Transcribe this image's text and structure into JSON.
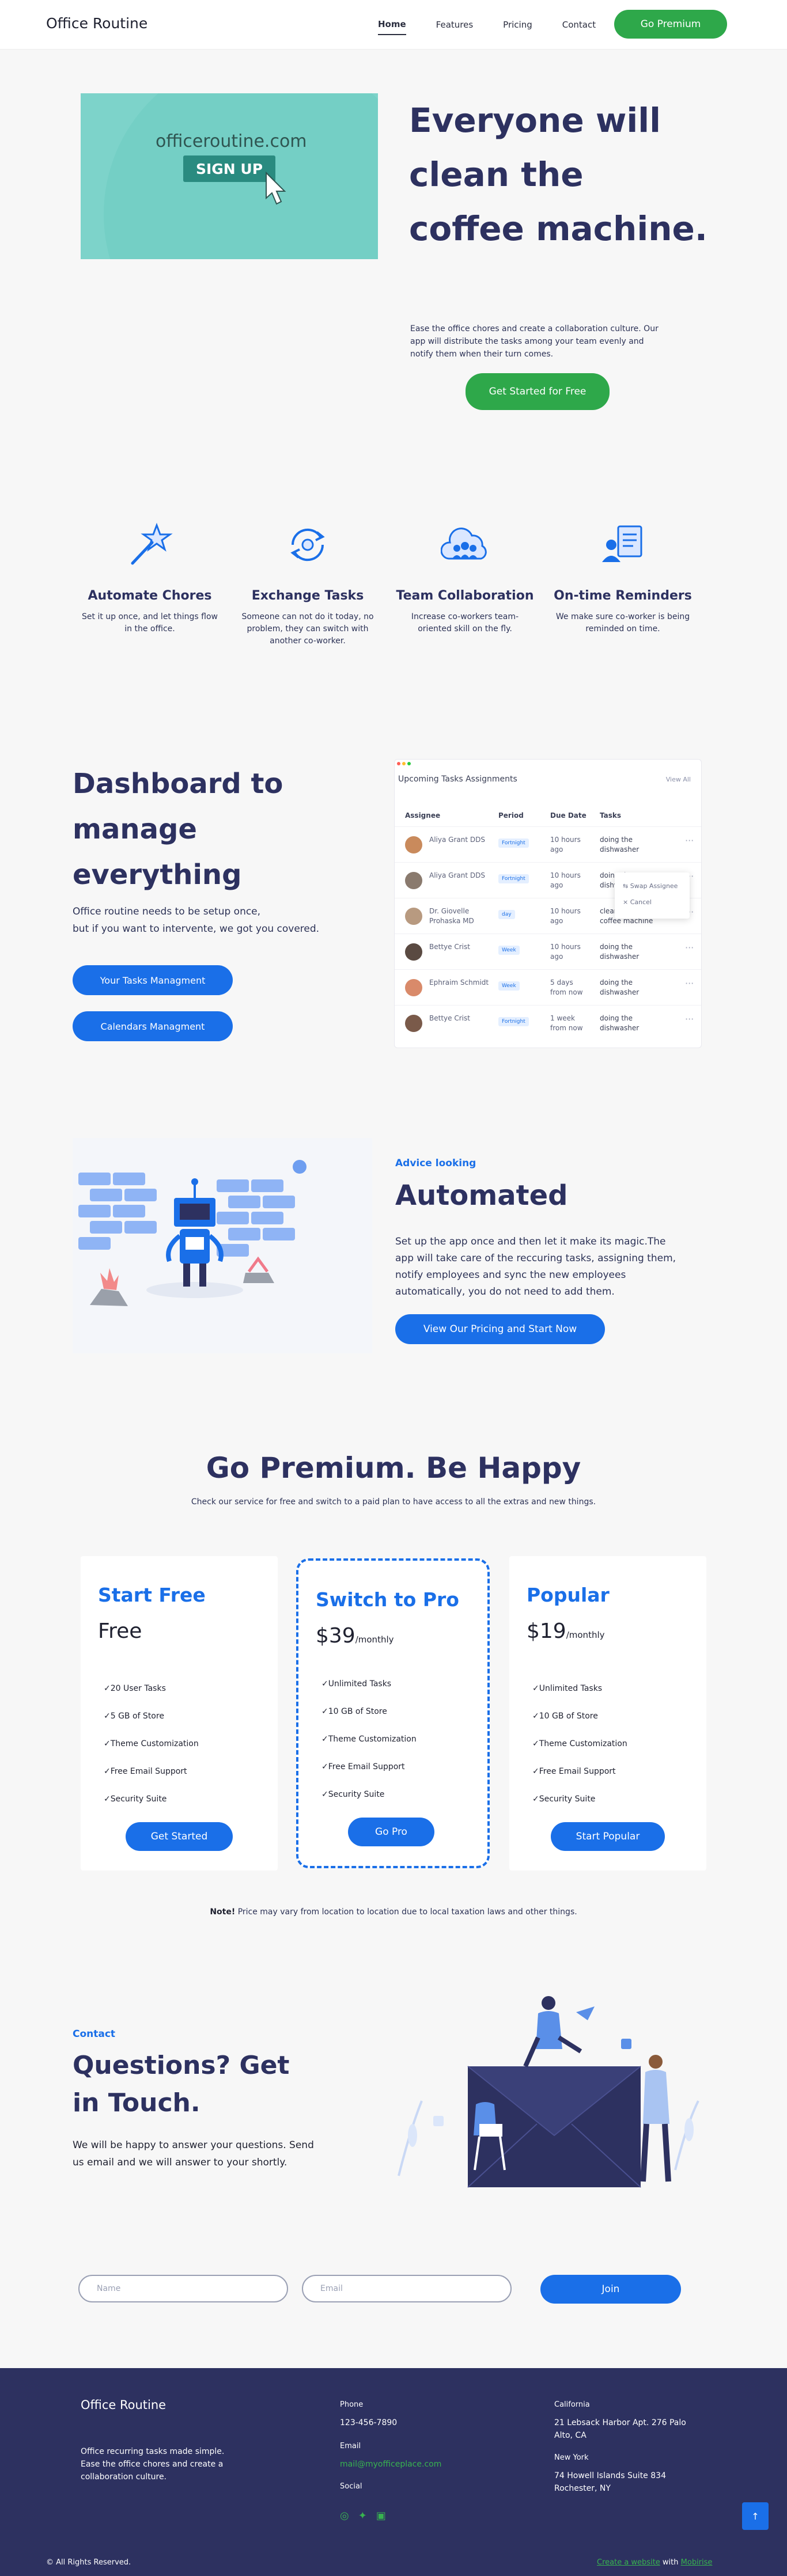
{
  "header": {
    "logo": "Office Routine",
    "nav": [
      "Home",
      "Features",
      "Pricing",
      "Contact"
    ],
    "cta": "Go Premium"
  },
  "hero": {
    "image_url_text": "officeroutine.com",
    "image_button_text": "SIGN UP",
    "title": "Everyone will clean the coffee machine.",
    "description": "Ease the office chores and create a collaboration culture. Our app will distribute the tasks among your team evenly and notify them when their turn comes.",
    "cta": "Get Started for Free"
  },
  "features": [
    {
      "title": "Automate Chores",
      "text": "Set it up once, and let things flow in the office.",
      "icon": "magic-wand-icon"
    },
    {
      "title": "Exchange Tasks",
      "text": "Someone can not do it today, no problem, they can switch with another co-worker.",
      "icon": "exchange-icon"
    },
    {
      "title": "Team Collaboration",
      "text": "Increase co-workers team-oriented skill on the fly.",
      "icon": "team-cloud-icon"
    },
    {
      "title": "On-time Reminders",
      "text": "We make sure co-worker is being reminded on time.",
      "icon": "reminder-icon"
    }
  ],
  "dashboard": {
    "title": "Dashboard to manage everything",
    "line1": "Office routine needs to be setup once,",
    "line2": "but if you want to intervente, we got you covered.",
    "button1": "Your Tasks Managment",
    "button2": "Calendars Managment",
    "panel": {
      "title": "Upcoming Tasks Assignments",
      "view_all": "View All",
      "headers": [
        "Assignee",
        "Period",
        "Due Date",
        "Tasks"
      ],
      "rows": [
        {
          "name": "Aliya Grant DDS",
          "period": "Fortnight",
          "due": "10 hours ago",
          "task": "doing the dishwasher",
          "more": "···"
        },
        {
          "name": "Aliya Grant DDS",
          "period": "Fortnight",
          "due": "10 hours ago",
          "task": "doing the dishwasher",
          "more": "···"
        },
        {
          "name": "Dr. Giovelle Prohaska MD",
          "period": "day",
          "due": "10 hours ago",
          "task": "cleaning the coffee machine",
          "more": "···"
        },
        {
          "name": "Bettye Crist",
          "period": "Week",
          "due": "10 hours ago",
          "task": "doing the dishwasher",
          "more": "···"
        },
        {
          "name": "Ephraim Schmidt",
          "period": "Week",
          "due": "5 days from now",
          "task": "doing the dishwasher",
          "more": "···"
        },
        {
          "name": "Bettye Crist",
          "period": "Fortnight",
          "due": "1 week from now",
          "task": "doing the dishwasher",
          "more": "···"
        }
      ],
      "menu": [
        "Swap Assignee",
        "Cancel"
      ],
      "menu_marks": [
        "⇆",
        "×"
      ]
    }
  },
  "automated": {
    "kicker": "Advice looking",
    "title": "Automated",
    "description": "Set up the app once and then let it make its magic.The app will take care of the reccuring tasks, assigning them, notify employees and sync the new employees automatically, you do not need to add them.",
    "cta": "View Our Pricing and Start Now"
  },
  "pricing": {
    "title": "Go Premium. Be Happy",
    "subtitle": "Check our service for free and switch to a paid plan to have access to all the extras and new things.",
    "plans": [
      {
        "name": "Start Free",
        "price": "Free",
        "period": "",
        "features": [
          "✓20 User Tasks",
          "✓5 GB of Store",
          "✓Theme Customization",
          "✓Free Email Support",
          "✓Security Suite"
        ],
        "cta": "Get Started"
      },
      {
        "name": "Switch to Pro",
        "price": "$39",
        "period": "/monthly",
        "features": [
          "✓Unlimited Tasks",
          "✓10 GB of Store",
          "✓Theme Customization",
          "✓Free Email Support",
          "✓Security Suite"
        ],
        "cta": "Go Pro"
      },
      {
        "name": "Popular",
        "price": "$19",
        "period": "/monthly",
        "features": [
          "✓Unlimited Tasks",
          "✓10 GB of Store",
          "✓Theme Customization",
          "✓Free Email Support",
          "✓Security Suite"
        ],
        "cta": "Start Popular"
      }
    ],
    "note_bold": "Note!",
    "note": "Price may vary from location to location due to local taxation laws and other things."
  },
  "contact": {
    "kicker": "Contact",
    "title": "Questions? Get in Touch.",
    "description": "We will be happy to answer your questions. Send us email and we will answer to your shortly.",
    "name_placeholder": "Name",
    "email_placeholder": "Email",
    "cta": "Join"
  },
  "footer": {
    "logo": "Office Routine",
    "tagline": "Office recurring tasks made simple. Ease the office chores and create a collaboration culture.",
    "phone_label": "Phone",
    "phone": "123-456-7890",
    "email_label": "Email",
    "email": "mail@myofficeplace.com",
    "social_label": "Social",
    "social_icons": [
      "whatsapp-icon",
      "twitter-icon",
      "linkedin-icon"
    ],
    "social_glyphs": [
      "◎",
      "✦",
      "▣"
    ],
    "loc1_label": "California",
    "loc1": "21 Lebsack Harbor Apt. 276 Palo Alto, CA",
    "loc2_label": "New York",
    "loc2": "74 Howell Islands Suite 834 Rochester, NY",
    "copyright": "© All Rights Reserved.",
    "credit_text1": "Create a website",
    "credit_text2": " with ",
    "credit_link": "Mobirise",
    "to_top": "↑"
  },
  "colors": {
    "green": "#2ea84a",
    "blue": "#1a6fe8",
    "navy": "#2d3160",
    "hero_image_bg": "#7dd3ca"
  }
}
